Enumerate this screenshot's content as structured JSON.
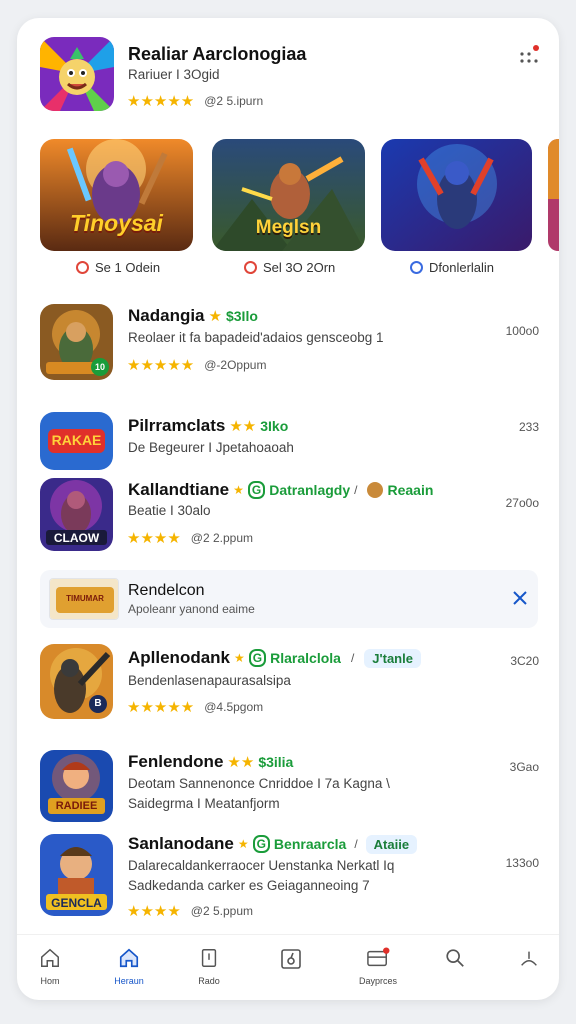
{
  "header": {
    "title": "Realiar Aarclonogiaa",
    "subtitle": "Rariuer I 3Ogid",
    "stars": "★★★★★",
    "meta": "@2 5.ipurn"
  },
  "banners": [
    {
      "title": "Tinoysai",
      "label": "Se 1 Odein"
    },
    {
      "title": "Meglsn",
      "label": "Sel 3O 2Orn"
    },
    {
      "title": "",
      "label": "Dfonlerlalin"
    }
  ],
  "apps": [
    {
      "title": "Nadangia",
      "badge_stars": "★",
      "badge_text": "$3Ilo",
      "line1": "Reolaer it fa bapadeid'adaios gensceobg 1",
      "line2": "",
      "stars": "★★★★★",
      "meta": "@-2Oppum",
      "right": "100o0",
      "icon_label": "",
      "icon_badge": "10"
    },
    {
      "title": "Pilrramclats",
      "badge_stars": "★★",
      "badge_text": "3Iko",
      "line1": "De Begeurer I Jpetahoaoah",
      "line2": "",
      "stars": "",
      "meta": "",
      "right": "233",
      "icon_label": "RAKAE",
      "icon_badge": ""
    },
    {
      "title": "Kallandtiane",
      "badge_stars": "★",
      "badge_text": "Datranlagdy",
      "extra_text": "Reaain",
      "line1": "Beatie I 30alo",
      "line2": "",
      "stars": "★★★★",
      "meta": "@2 2.ppum",
      "right": "27o0o",
      "icon_label": "CLAOW",
      "icon_badge": ""
    },
    {
      "title": "Apllenodank",
      "badge_stars": "★",
      "badge_text": "Rlaralclola",
      "pill": "J'tanle",
      "line1": "Bendenlasenapaurasalsipa",
      "line2": "",
      "stars": "★★★★★",
      "meta": "@4.5pgom",
      "right": "3C20",
      "icon_label": "",
      "icon_badge": "B"
    },
    {
      "title": "Fenlendone",
      "badge_stars": "★★",
      "badge_text": "$3ilia",
      "line1": "Deotam Sannenonce Cnriddoe I 7a Kagna \\",
      "line2": "Saidegrma I Meatanfjorm",
      "stars": "",
      "meta": "",
      "right": "3Gao",
      "icon_label": "RADIEE",
      "icon_badge": ""
    },
    {
      "title": "Sanlanodane",
      "badge_stars": "★",
      "badge_text": "Benraarcla",
      "pill": "Ataiie",
      "line1": "Dalarecaldankerraocer Uenstanka Nerkatl Iq",
      "line2": "Sadkedanda carker es Geiaganneoing 7",
      "stars": "★★★★",
      "meta": "@2 5.ppum",
      "right": "133o0",
      "icon_label": "GENCLA",
      "icon_badge": ""
    }
  ],
  "notice": {
    "thumb_text": "TIMUMAR",
    "title": "Rendelcon",
    "subtitle": "Apoleanr yanond eaime"
  },
  "nav": [
    {
      "label": "Hom",
      "icon": "home-icon"
    },
    {
      "label": "Heraun",
      "icon": "home-filled-icon",
      "active": true
    },
    {
      "label": "Rado",
      "icon": "tablet-icon"
    },
    {
      "label": "",
      "icon": "note-icon"
    },
    {
      "label": "Dayprces",
      "icon": "wallet-icon"
    },
    {
      "label": "",
      "icon": "search-icon"
    },
    {
      "label": "",
      "icon": "person-icon"
    }
  ],
  "colors": {
    "accent": "#1656c9",
    "green": "#1a9c3a",
    "star": "#f5b400",
    "badge_red": "#e0302a"
  }
}
